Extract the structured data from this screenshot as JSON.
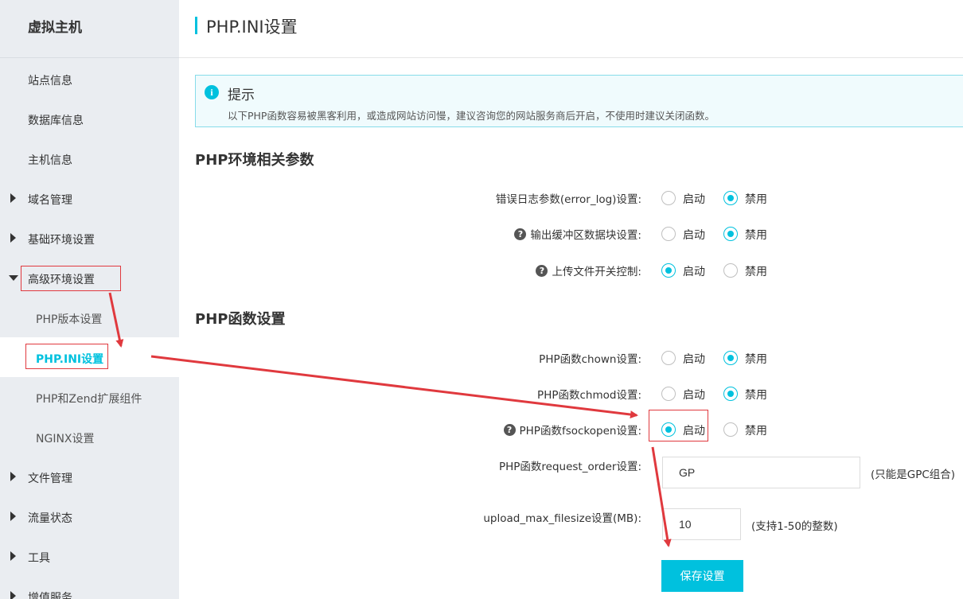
{
  "sidebar": {
    "title": "虚拟主机",
    "items": [
      {
        "label": "站点信息"
      },
      {
        "label": "数据库信息"
      },
      {
        "label": "主机信息"
      },
      {
        "label": "域名管理"
      },
      {
        "label": "基础环境设置"
      },
      {
        "label": "高级环境设置"
      },
      {
        "label": "PHP版本设置"
      },
      {
        "label": "PHP.INI设置"
      },
      {
        "label": "PHP和Zend扩展组件"
      },
      {
        "label": "NGINX设置"
      },
      {
        "label": "文件管理"
      },
      {
        "label": "流量状态"
      },
      {
        "label": "工具"
      },
      {
        "label": "增值服务"
      }
    ]
  },
  "header": {
    "title": "PHP.INI设置"
  },
  "tip": {
    "icon": "info-icon",
    "title": "提示",
    "text": "以下PHP函数容易被黑客利用，或造成网站访问慢，建议咨询您的网站服务商后开启，不使用时建议关闭函数。"
  },
  "section_env": {
    "title": "PHP环境相关参数",
    "rows": [
      {
        "label": "错误日志参数(error_log)设置:",
        "selected": "禁用"
      },
      {
        "label": "输出缓冲区数据块设置:",
        "selected": "禁用"
      },
      {
        "label": "上传文件开关控制:",
        "selected": "启动"
      }
    ]
  },
  "section_func": {
    "title": "PHP函数设置",
    "rows": [
      {
        "label": "PHP函数chown设置:",
        "selected": "禁用"
      },
      {
        "label": "PHP函数chmod设置:",
        "selected": "禁用"
      },
      {
        "label": "PHP函数fsockopen设置:",
        "selected": "启动"
      }
    ],
    "request_order": {
      "label": "PHP函数request_order设置:",
      "value": "GP",
      "hint": "(只能是GPC组合)"
    },
    "upload_max": {
      "label": "upload_max_filesize设置(MB):",
      "value": "10",
      "hint": "(支持1-50的整数)"
    }
  },
  "options": {
    "enable": "启动",
    "disable": "禁用"
  },
  "save_label": "保存设置",
  "colors": {
    "accent": "#00c1de",
    "annotation": "#e0393e",
    "sidebar_bg": "#eaedf1"
  }
}
